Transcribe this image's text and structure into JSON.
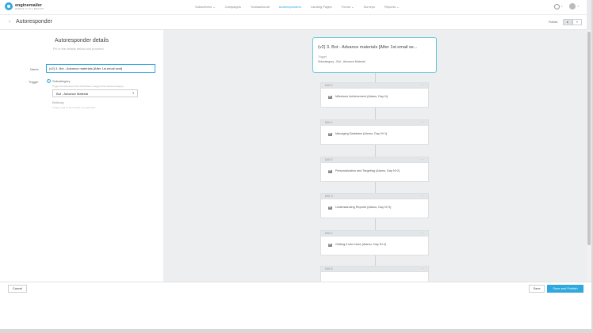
{
  "brand": {
    "name": "enginemailer",
    "tagline": "WHERE IT ALL BEGINS"
  },
  "nav": {
    "items": [
      {
        "label": "Subscribers",
        "dropdown": true,
        "active": false
      },
      {
        "label": "Campaigns",
        "dropdown": false,
        "active": false
      },
      {
        "label": "Transactional",
        "dropdown": false,
        "active": false
      },
      {
        "label": "Autoresponders",
        "dropdown": false,
        "active": true
      },
      {
        "label": "Landing Pages",
        "dropdown": false,
        "active": false
      },
      {
        "label": "Forms",
        "dropdown": true,
        "active": false
      },
      {
        "label": "Surveys",
        "dropdown": false,
        "active": false
      },
      {
        "label": "Reports",
        "dropdown": true,
        "active": false
      }
    ]
  },
  "header": {
    "title": "Autoresponder",
    "publish_label": "Publish",
    "toggle_list_glyph": "≡",
    "toggle_flow_glyph": "▸"
  },
  "form": {
    "title": "Autoresponder details",
    "subtitle": "Fill in the details below and proceed",
    "name_label": "Name",
    "name_value": "(v2) 3. Bot - Advance materials [After 1st email sent]",
    "trigger_label": "Trigger",
    "trigger_option": "Subcategory",
    "trigger_help": "Trigger this sequence when subscribers is tagged with selected category",
    "subcategory_value": "Bot - Advance Material",
    "birthday_label": "Birthday",
    "birthday_help": "Trigger email on the birthday of a subscriber"
  },
  "flow": {
    "trigger_card": {
      "title": "(v2) 3. Bot - Advance materials [After 1st email se...",
      "label": "Trigger",
      "value": "Subcategory - Bot - Advance Material"
    },
    "days": [
      {
        "label": "DAY 0",
        "email": "Milestone Achievement (Alamu, Day N)"
      },
      {
        "label": "DAY 1",
        "email": "Managing Database (Alamu, Day N+1)"
      },
      {
        "label": "DAY 2",
        "email": "Personalization and Targeting (Alamu, Day N+2)"
      },
      {
        "label": "DAY 3",
        "email": "Understanding Reports (Alamu, Day N+3)"
      },
      {
        "label": "DAY 4",
        "email": "Getting it into Inbox (Alamu, Day N+4)"
      },
      {
        "label": "DAY 5",
        "email": ""
      }
    ]
  },
  "footer": {
    "cancel_label": "Cancel",
    "save_label": "Save",
    "save_publish_label": "Save and Publish"
  },
  "colors": {
    "accent": "#35a8e0",
    "primary_button": "#2ea8dd",
    "trigger_border": "#6cc8dc"
  }
}
